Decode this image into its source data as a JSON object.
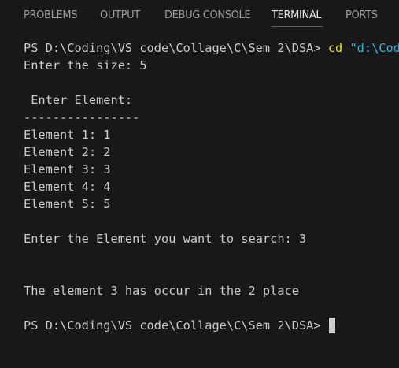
{
  "tabs": [
    {
      "label": "PROBLEMS"
    },
    {
      "label": "OUTPUT"
    },
    {
      "label": "DEBUG CONSOLE"
    },
    {
      "label": "TERMINAL"
    },
    {
      "label": "PORTS"
    }
  ],
  "active_tab": "TERMINAL",
  "terminal": {
    "prompt1": "PS D:\\Coding\\VS code\\Collage\\C\\Sem 2\\DSA> ",
    "command": "cd",
    "command_arg": " \"d:\\Codi",
    "size_prompt": "Enter the size: 5",
    "enter_element": " Enter Element:",
    "separator": "----------------",
    "elements": [
      "Element 1: 1",
      "Element 2: 2",
      "Element 3: 3",
      "Element 4: 4",
      "Element 5: 5"
    ],
    "search_prompt": "Enter the Element you want to search: 3",
    "result": "The element 3 has occur in the 2 place",
    "prompt2": "PS D:\\Coding\\VS code\\Collage\\C\\Sem 2\\DSA> "
  },
  "colors": {
    "background": "#181818",
    "text": "#cccccc",
    "command": "#e5e510",
    "string": "#29b8db",
    "tab_inactive": "#9d9d9d",
    "tab_active": "#e7e7e7",
    "tab_underline": "#0078d4"
  }
}
